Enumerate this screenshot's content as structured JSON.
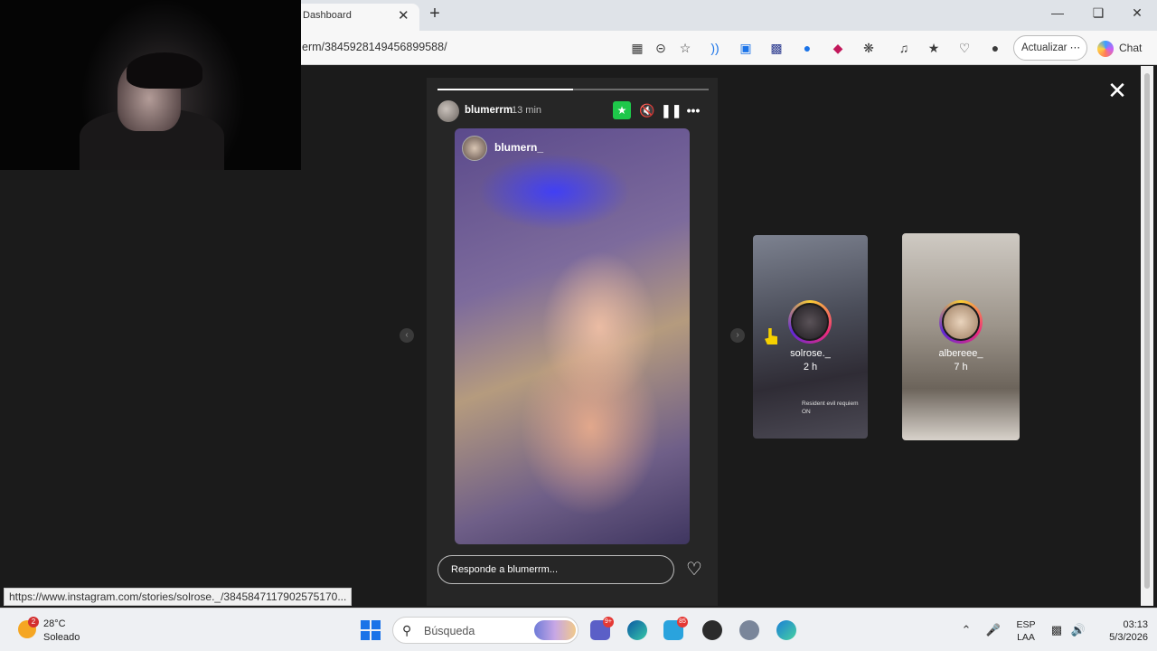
{
  "browser": {
    "tab_title": "Dashboard",
    "tab_close": "✕",
    "new_tab": "+",
    "url": "erm/3845928149456899588/",
    "update_button": "Actualizar ⋯",
    "chat_button": "Chat",
    "window_controls": [
      "—",
      "❏",
      "✕"
    ]
  },
  "story": {
    "username": "blumerrm",
    "time": "13 min",
    "progress": 0.5,
    "image_username": "blumern_",
    "reply_placeholder": "Responde a blumerrm...",
    "close": "✕"
  },
  "up_next": [
    {
      "name": "solrose._",
      "time": "2 h",
      "caption": "Resident evil requiem ON"
    },
    {
      "name": "albereee_",
      "time": "7 h"
    }
  ],
  "status_bar_url": "https://www.instagram.com/stories/solrose._/3845847117902575170...",
  "taskbar": {
    "weather_badge": "2",
    "temperature": "28°C",
    "condition": "Soleado",
    "search_placeholder": "Búsqueda",
    "badges": {
      "teams": "9+",
      "telegram": "85"
    },
    "language_line1": "ESP",
    "language_line2": "LAA",
    "time": "03:13",
    "date": "5/3/2026"
  },
  "colors": {
    "accent_green": "#1ec74a",
    "background_dark": "#1b1b1b",
    "story_ring": "#ee2a7b"
  }
}
